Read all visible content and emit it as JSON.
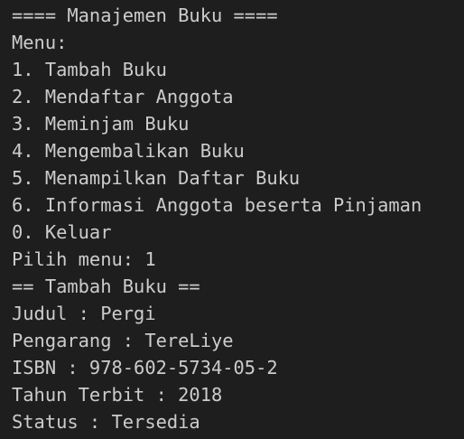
{
  "terminal": {
    "lines": [
      "==== Manajemen Buku ====",
      "Menu:",
      "1. Tambah Buku",
      "2. Mendaftar Anggota",
      "3. Meminjam Buku",
      "4. Mengembalikan Buku",
      "5. Menampilkan Daftar Buku",
      "6. Informasi Anggota beserta Pinjaman",
      "0. Keluar",
      "Pilih menu: 1",
      "== Tambah Buku ==",
      "Judul : Pergi",
      "Pengarang : TereLiye",
      "ISBN : 978-602-5734-05-2",
      "Tahun Terbit : 2018",
      "Status : Tersedia"
    ]
  },
  "colors": {
    "background": "#1e1e1e",
    "text": "#cccccc"
  }
}
